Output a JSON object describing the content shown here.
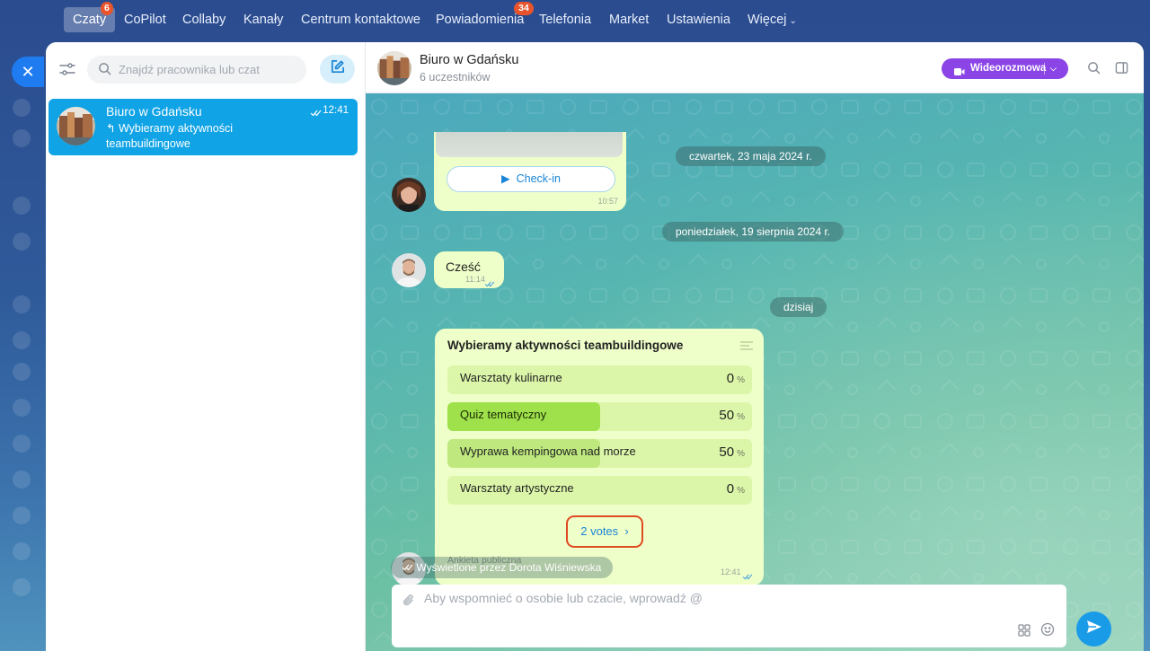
{
  "topnav": {
    "items": [
      {
        "label": "Czaty",
        "badge": "6"
      },
      {
        "label": "CoPilot"
      },
      {
        "label": "Collaby"
      },
      {
        "label": "Kanały"
      },
      {
        "label": "Centrum kontaktowe"
      },
      {
        "label": "Powiadomienia",
        "badge": "34"
      },
      {
        "label": "Telefonia"
      },
      {
        "label": "Market"
      },
      {
        "label": "Ustawienia"
      },
      {
        "label": "Więcej"
      }
    ]
  },
  "sidebar": {
    "search_placeholder": "Znajdź pracownika lub czat",
    "chats": [
      {
        "name": "Biuro w Gdańsku",
        "time": "12:41",
        "preview_icon": "↰",
        "preview": "Wybieramy aktywności teambuildingowe"
      }
    ]
  },
  "header": {
    "title": "Biuro w Gdańsku",
    "subtitle": "6 uczestników",
    "video_label": "Wideorozmowa"
  },
  "messages": {
    "checkin": {
      "button_label": "Check-in",
      "time": "10:57"
    },
    "dates": [
      "czwartek, 23 maja 2024 r.",
      "poniedziałek, 19 sierpnia 2024 r.",
      "dzisiaj"
    ],
    "hello": {
      "text": "Cześć",
      "time": "11:14"
    },
    "poll": {
      "title": "Wybieramy aktywności teambuildingowe",
      "options": [
        {
          "label": "Warsztaty kulinarne",
          "percent": 0,
          "percent_text": "0",
          "selected": false
        },
        {
          "label": "Quiz tematyczny",
          "percent": 50,
          "percent_text": "50",
          "selected": true
        },
        {
          "label": "Wyprawa kempingowa nad morze",
          "percent": 50,
          "percent_text": "50",
          "selected": false
        },
        {
          "label": "Warsztaty artystyczne",
          "percent": 0,
          "percent_text": "0",
          "selected": false
        }
      ],
      "percent_sign": "%",
      "votes_label": "2 votes",
      "type_label": "Ankieta publiczna",
      "time": "12:41"
    },
    "seen_label": "Wyświetlone przez Dorota Wiśniewska"
  },
  "composer": {
    "placeholder": "Aby wspomnieć o osobie lub czacie, wprowadź @"
  },
  "colors": {
    "accent": "#10a3e6",
    "video": "#8b44e6",
    "bubble": "#efffc9",
    "poll_fill": "#9ee14a",
    "highlight": "#e04a23"
  }
}
